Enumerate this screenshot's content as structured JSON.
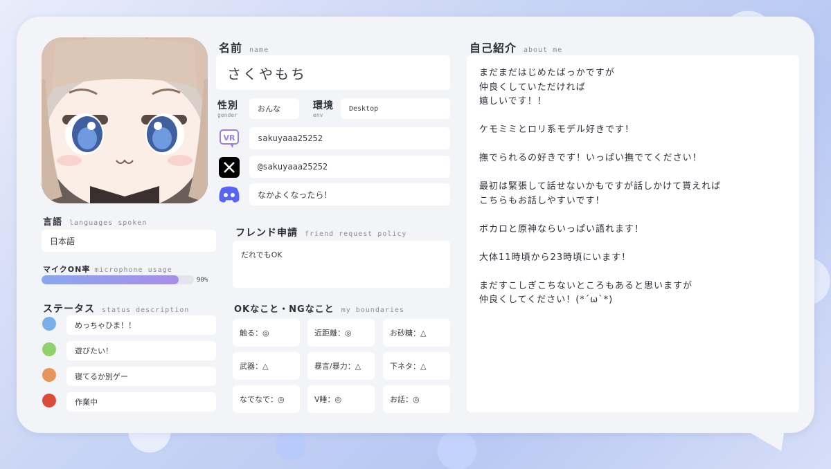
{
  "profile": {
    "name_heading": "名前",
    "name_sub": "name",
    "name_value": "さくやもち",
    "gender_heading": "性別",
    "gender_sub": "gender",
    "gender_value": "おんな",
    "env_heading": "環境",
    "env_sub": "env",
    "env_value": "Desktop"
  },
  "socials": [
    {
      "icon": "vrchat-icon",
      "value": "sakuyaaa25252"
    },
    {
      "icon": "x-icon",
      "value": "@sakuyaaa25252"
    },
    {
      "icon": "discord-icon",
      "value": "なかよくなったら！"
    }
  ],
  "languages": {
    "heading": "言語",
    "sub": "languages spoken",
    "value": "日本語"
  },
  "mic": {
    "heading": "マイクON率",
    "sub": "microphone usage",
    "percent_label": "90%",
    "fraction": 0.9
  },
  "status": {
    "heading": "ステータス",
    "sub": "status description",
    "items": [
      {
        "color": "#7aaeea",
        "label": "めっちゃひま！！"
      },
      {
        "color": "#92d06e",
        "label": "遊びたい！"
      },
      {
        "color": "#e8955a",
        "label": "寝てるか別ゲー"
      },
      {
        "color": "#dc4a3a",
        "label": "作業中"
      }
    ]
  },
  "friend": {
    "heading": "フレンド申請",
    "sub": "friend request policy",
    "value": "だれでもOK"
  },
  "boundaries": {
    "heading": "OKなこと・NGなこと",
    "sub": "my boundaries",
    "cells": [
      "触る：◎",
      "近距離：◎",
      "お砂糖：△",
      "武器：△",
      "暴言/暴力：△",
      "下ネタ：△",
      "なでなで：◎",
      "V睡：◎",
      "お話：◎"
    ]
  },
  "about": {
    "heading": "自己紹介",
    "sub": "about me",
    "text": "まだまだはじめたばっかですが\n仲良くしていただければ\n嬉しいです！！\n\nケモミミとロリ系モデル好きです！\n\n撫でられるの好きです！いっぱい撫でてください！\n\n最初は緊張して話せないかもですが話しかけて貰えれば\nこちらもお話しやすいです！\n\nボカロと原神ならいっぱい語れます！\n\n大体11時頃から23時頃にいます！\n\nまだすこしぎこちないところもあると思いますが\n仲良くしてください！(*´ω`*)"
  },
  "colors": {
    "card": "#f3f4f8",
    "discord": "#5865f2",
    "vrchat": "#9a7ee6",
    "mic_gradient_start": "#8aa6ef",
    "mic_gradient_end": "#a88ee8"
  }
}
